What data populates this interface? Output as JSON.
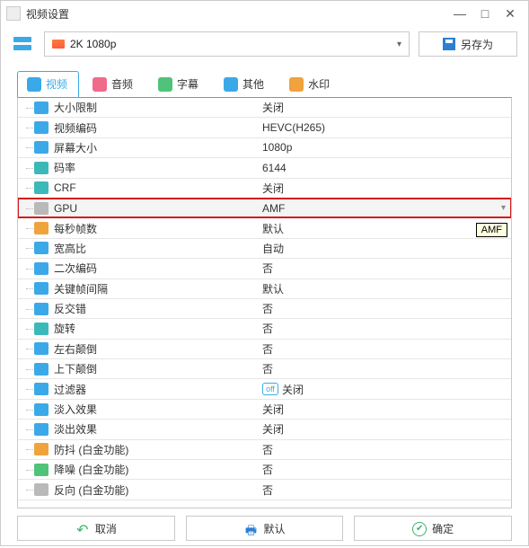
{
  "window": {
    "title": "视频设置",
    "min": "—",
    "max": "□",
    "close": "✕"
  },
  "topbar": {
    "preset": "2K 1080p",
    "saveas": "另存为"
  },
  "tabs": [
    {
      "label": "视频",
      "active": true
    },
    {
      "label": "音频",
      "active": false
    },
    {
      "label": "字幕",
      "active": false
    },
    {
      "label": "其他",
      "active": false
    },
    {
      "label": "水印",
      "active": false
    }
  ],
  "rows": [
    {
      "icon": "c-blue",
      "label": "大小限制",
      "value": "关闭"
    },
    {
      "icon": "c-blue",
      "label": "视频编码",
      "value": "HEVC(H265)"
    },
    {
      "icon": "c-blue",
      "label": "屏幕大小",
      "value": "1080p"
    },
    {
      "icon": "c-teal",
      "label": "码率",
      "value": "6144"
    },
    {
      "icon": "c-teal",
      "label": "CRF",
      "value": "关闭"
    },
    {
      "icon": "c-gray",
      "label": "GPU",
      "value": "AMF",
      "highlight": true,
      "dropdown": true
    },
    {
      "icon": "c-orange",
      "label": "每秒帧数",
      "value": "默认"
    },
    {
      "icon": "c-blue",
      "label": "宽高比",
      "value": "自动"
    },
    {
      "icon": "c-blue",
      "label": "二次编码",
      "value": "否"
    },
    {
      "icon": "c-blue",
      "label": "关键帧间隔",
      "value": "默认"
    },
    {
      "icon": "c-blue",
      "label": "反交错",
      "value": "否"
    },
    {
      "icon": "c-teal",
      "label": "旋转",
      "value": "否"
    },
    {
      "icon": "c-blue",
      "label": "左右颠倒",
      "value": "否"
    },
    {
      "icon": "c-blue",
      "label": "上下颠倒",
      "value": "否"
    },
    {
      "icon": "c-blue",
      "label": "过滤器",
      "value": "关闭",
      "badge": "off"
    },
    {
      "icon": "c-blue",
      "label": "淡入效果",
      "value": "关闭"
    },
    {
      "icon": "c-blue",
      "label": "淡出效果",
      "value": "关闭"
    },
    {
      "icon": "c-orange",
      "label": "防抖 (白金功能)",
      "value": "否"
    },
    {
      "icon": "c-green",
      "label": "降噪 (白金功能)",
      "value": "否"
    },
    {
      "icon": "c-gray",
      "label": "反向 (白金功能)",
      "value": "否"
    }
  ],
  "tooltip": "AMF",
  "footer": {
    "cancel": "取消",
    "default": "默认",
    "ok": "确定"
  }
}
